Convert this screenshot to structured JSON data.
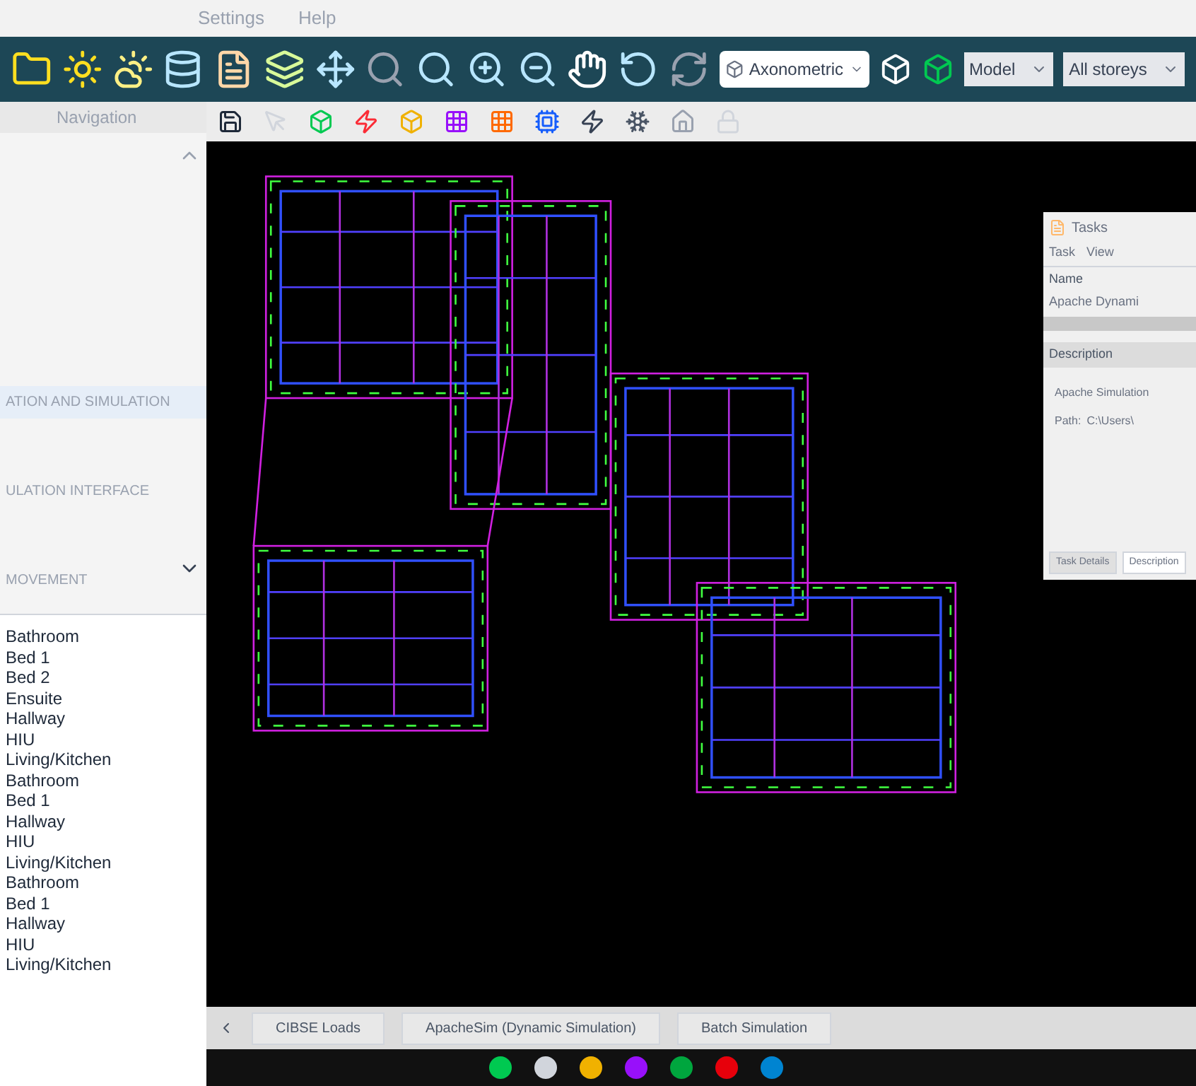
{
  "menu": [
    "Settings",
    "Help"
  ],
  "toolbar": {
    "view_mode": "Axonometric",
    "model": "Model",
    "storeys": "All storeys"
  },
  "navigation": {
    "tab": "Navigation",
    "categories": [
      {
        "label": "ATION AND SIMULATION",
        "selected": true
      },
      {
        "label": "ULATION INTERFACE",
        "selected": false
      },
      {
        "label": "MOVEMENT",
        "selected": false
      }
    ],
    "rooms": [
      "Bathroom",
      "Bed 1",
      "Bed 2",
      "Ensuite",
      "Hallway",
      "HIU",
      "Living/Kitchen",
      "Bathroom",
      "Bed 1",
      "Hallway",
      "HIU",
      "Living/Kitchen",
      "Bathroom",
      "Bed 1",
      "Hallway",
      "HIU",
      "Living/Kitchen"
    ]
  },
  "tasks_window": {
    "title": "Tasks",
    "menu": [
      "Task",
      "View"
    ],
    "name_header": "Name",
    "tree_item": "Apache Dynami",
    "description_header": "Description",
    "description": "Apache Simulation",
    "path_label": "Path:",
    "path_value": "C:\\Users\\",
    "tabs": [
      {
        "label": "Task Details",
        "selected": false
      },
      {
        "label": "Description",
        "selected": true
      }
    ]
  },
  "bottom_buttons": [
    "CIBSE Loads",
    "ApacheSim (Dynamic Simulation)",
    "Batch Simulation"
  ]
}
